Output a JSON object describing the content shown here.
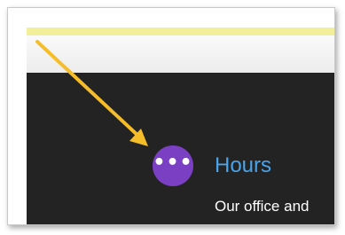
{
  "section": {
    "title": "Hours",
    "body_text": "Our office and",
    "more_button_icon": "more-dots-icon",
    "more_button_glyph": "•••"
  },
  "annotation": {
    "arrow_icon": "arrow-icon",
    "arrow_color": "#f5bd2a"
  },
  "colors": {
    "top_strip": "#f2ef9a",
    "dark_panel": "#232323",
    "accent_button": "#7b3fc4",
    "title_blue": "#4aa3e8"
  }
}
